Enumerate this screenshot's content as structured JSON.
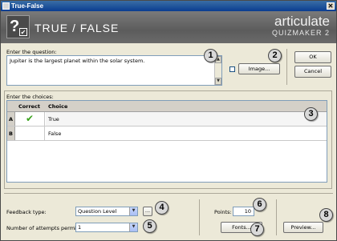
{
  "window": {
    "title": "True-False"
  },
  "header": {
    "title": "TRUE / FALSE",
    "brand_name": "articulate",
    "brand_product": "QUIZMAKER 2"
  },
  "question": {
    "label": "Enter the question:",
    "value": "Jupiter is  the largest planet within the solar system."
  },
  "buttons": {
    "image": "Image...",
    "ok": "OK",
    "cancel": "Cancel",
    "fonts": "Fonts...",
    "preview": "Preview..."
  },
  "choices": {
    "label": "Enter the choices:",
    "columns": [
      "Correct",
      "Choice"
    ],
    "rows": [
      {
        "letter": "A",
        "correct": true,
        "choice": "True"
      },
      {
        "letter": "B",
        "correct": false,
        "choice": "False"
      }
    ]
  },
  "feedback": {
    "label": "Feedback type:",
    "value": "Question Level",
    "more": "..."
  },
  "attempts": {
    "label": "Number of attempts permitted:",
    "value": "1"
  },
  "points": {
    "label": "Points:",
    "value": "10"
  },
  "callouts": [
    "1",
    "2",
    "3",
    "4",
    "5",
    "6",
    "7",
    "8"
  ],
  "icons": {
    "check": "✔",
    "dropdown": "▼",
    "scroll_up": "▲",
    "scroll_down": "▼",
    "close": "✕"
  },
  "colors": {
    "check": "#3aa31c",
    "titlebar": "#0a3d91"
  }
}
